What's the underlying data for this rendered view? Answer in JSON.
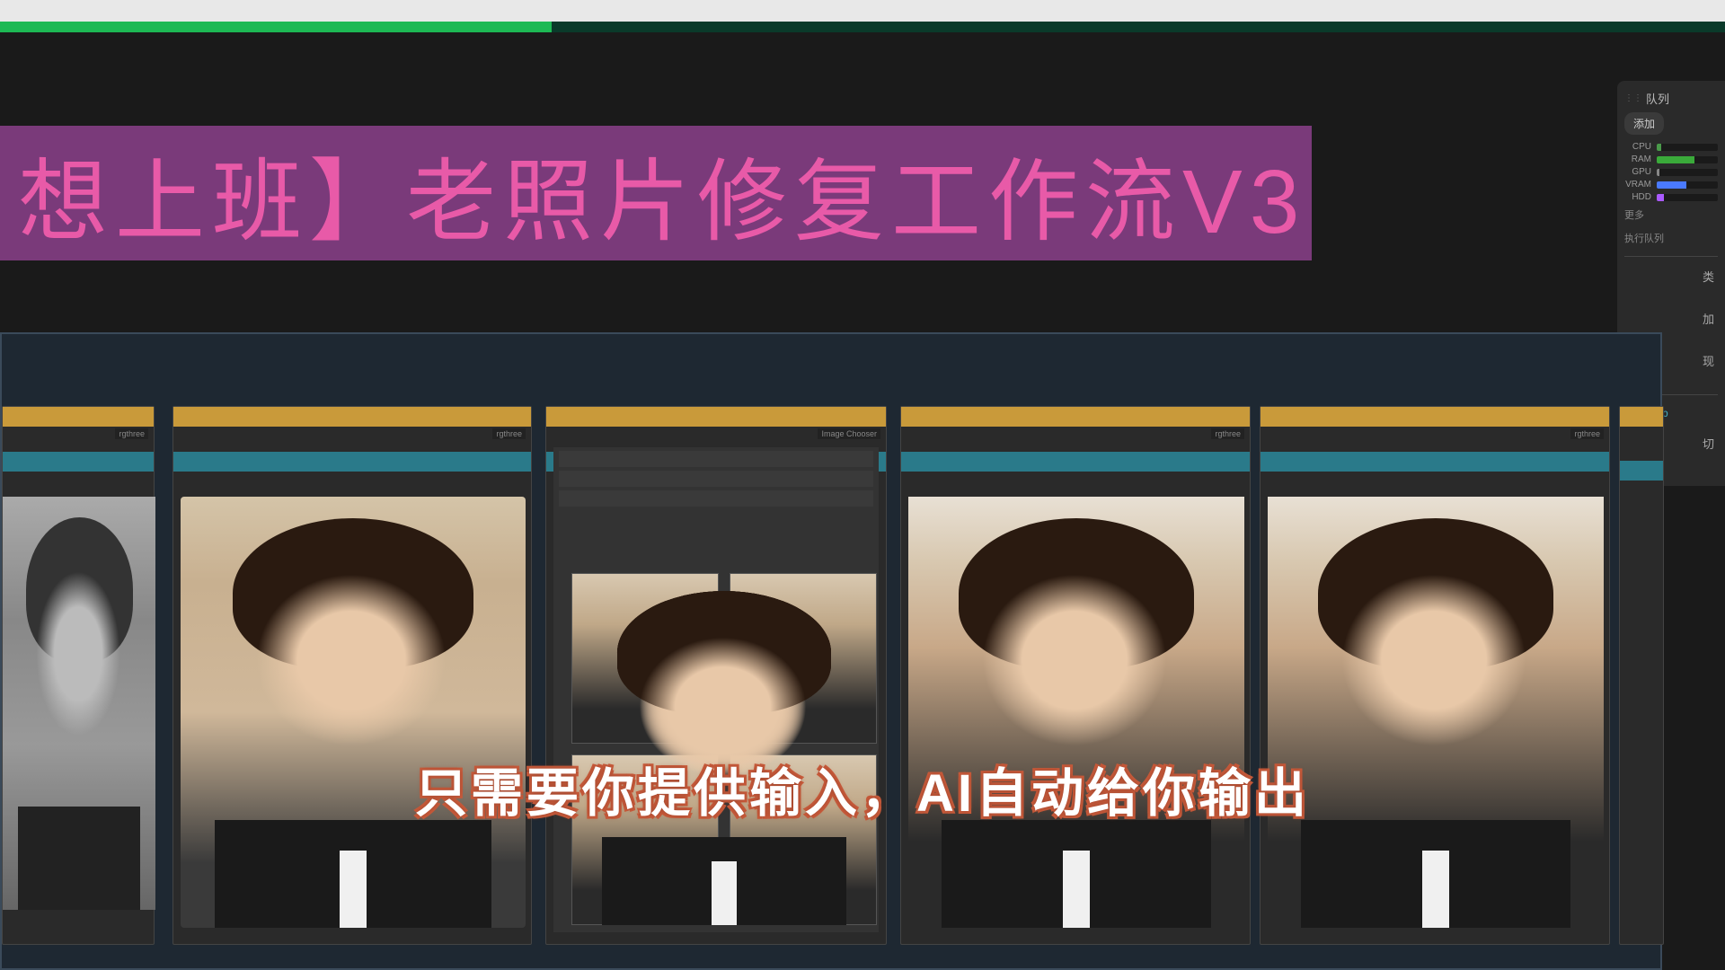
{
  "progress": {
    "percent": 32
  },
  "title": "想上班】老照片修复工作流V3",
  "sidebar": {
    "queue_label": "队列",
    "add_btn": "添加",
    "meters": [
      {
        "label": "CPU",
        "value": 8,
        "color": "#4a9a4a"
      },
      {
        "label": "RAM",
        "value": 62,
        "color": "#3aaa3a"
      },
      {
        "label": "GPU",
        "value": 5,
        "color": "#888"
      },
      {
        "label": "VRAM",
        "value": 48,
        "color": "#4a7aff"
      },
      {
        "label": "HDD",
        "value": 12,
        "color": "#aa5aff"
      }
    ],
    "more": "更多",
    "exec_queue": "执行队列",
    "items": [
      "类",
      "加",
      "现"
    ],
    "mixlab": "Mixlab",
    "switch": "切"
  },
  "nodes": {
    "n1_label": "rgthree",
    "n2_label": "rgthree",
    "n3_label": "Image Chooser",
    "n4_label": "rgthree",
    "n5_label": "rgthree"
  },
  "subtitle": "只需要你提供输入，AI自动给你输出"
}
